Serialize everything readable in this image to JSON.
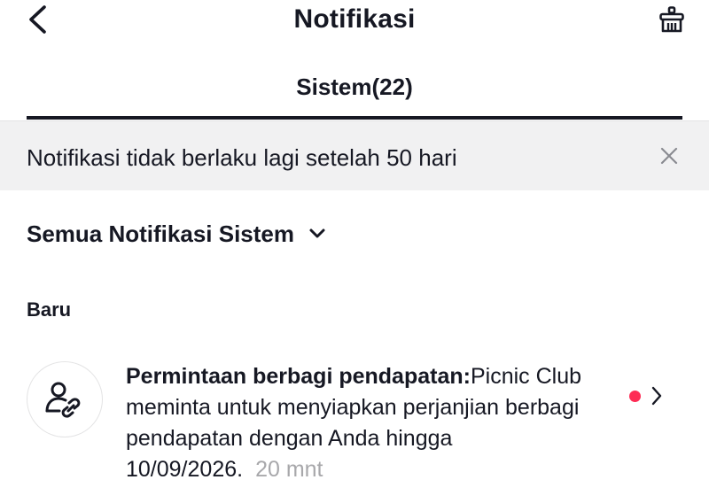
{
  "header": {
    "title": "Notifikasi",
    "back_icon": "chevron-left-icon",
    "action_icon": "broom-icon"
  },
  "tabs": [
    {
      "label": "Sistem(22)",
      "active": true
    }
  ],
  "banner": {
    "text": "Notifikasi tidak berlaku lagi setelah 50 hari",
    "close_icon": "close-icon"
  },
  "filter": {
    "label": "Semua Notifikasi Sistem",
    "icon": "chevron-down-icon"
  },
  "section": {
    "label": "Baru"
  },
  "notifications": [
    {
      "icon": "user-link-icon",
      "title": "Permintaan berbagi pendapatan:",
      "body": "Picnic Club meminta untuk menyiapkan perjanjian berbagi pendapatan dengan Anda hingga 10/09/2026.",
      "time": "20 mnt",
      "unread": true
    }
  ],
  "colors": {
    "text": "#161823",
    "muted": "#a8a8ab",
    "banner_bg": "#f1f1f2",
    "unread_dot": "#fe2c55",
    "divider": "#e3e3e4"
  }
}
